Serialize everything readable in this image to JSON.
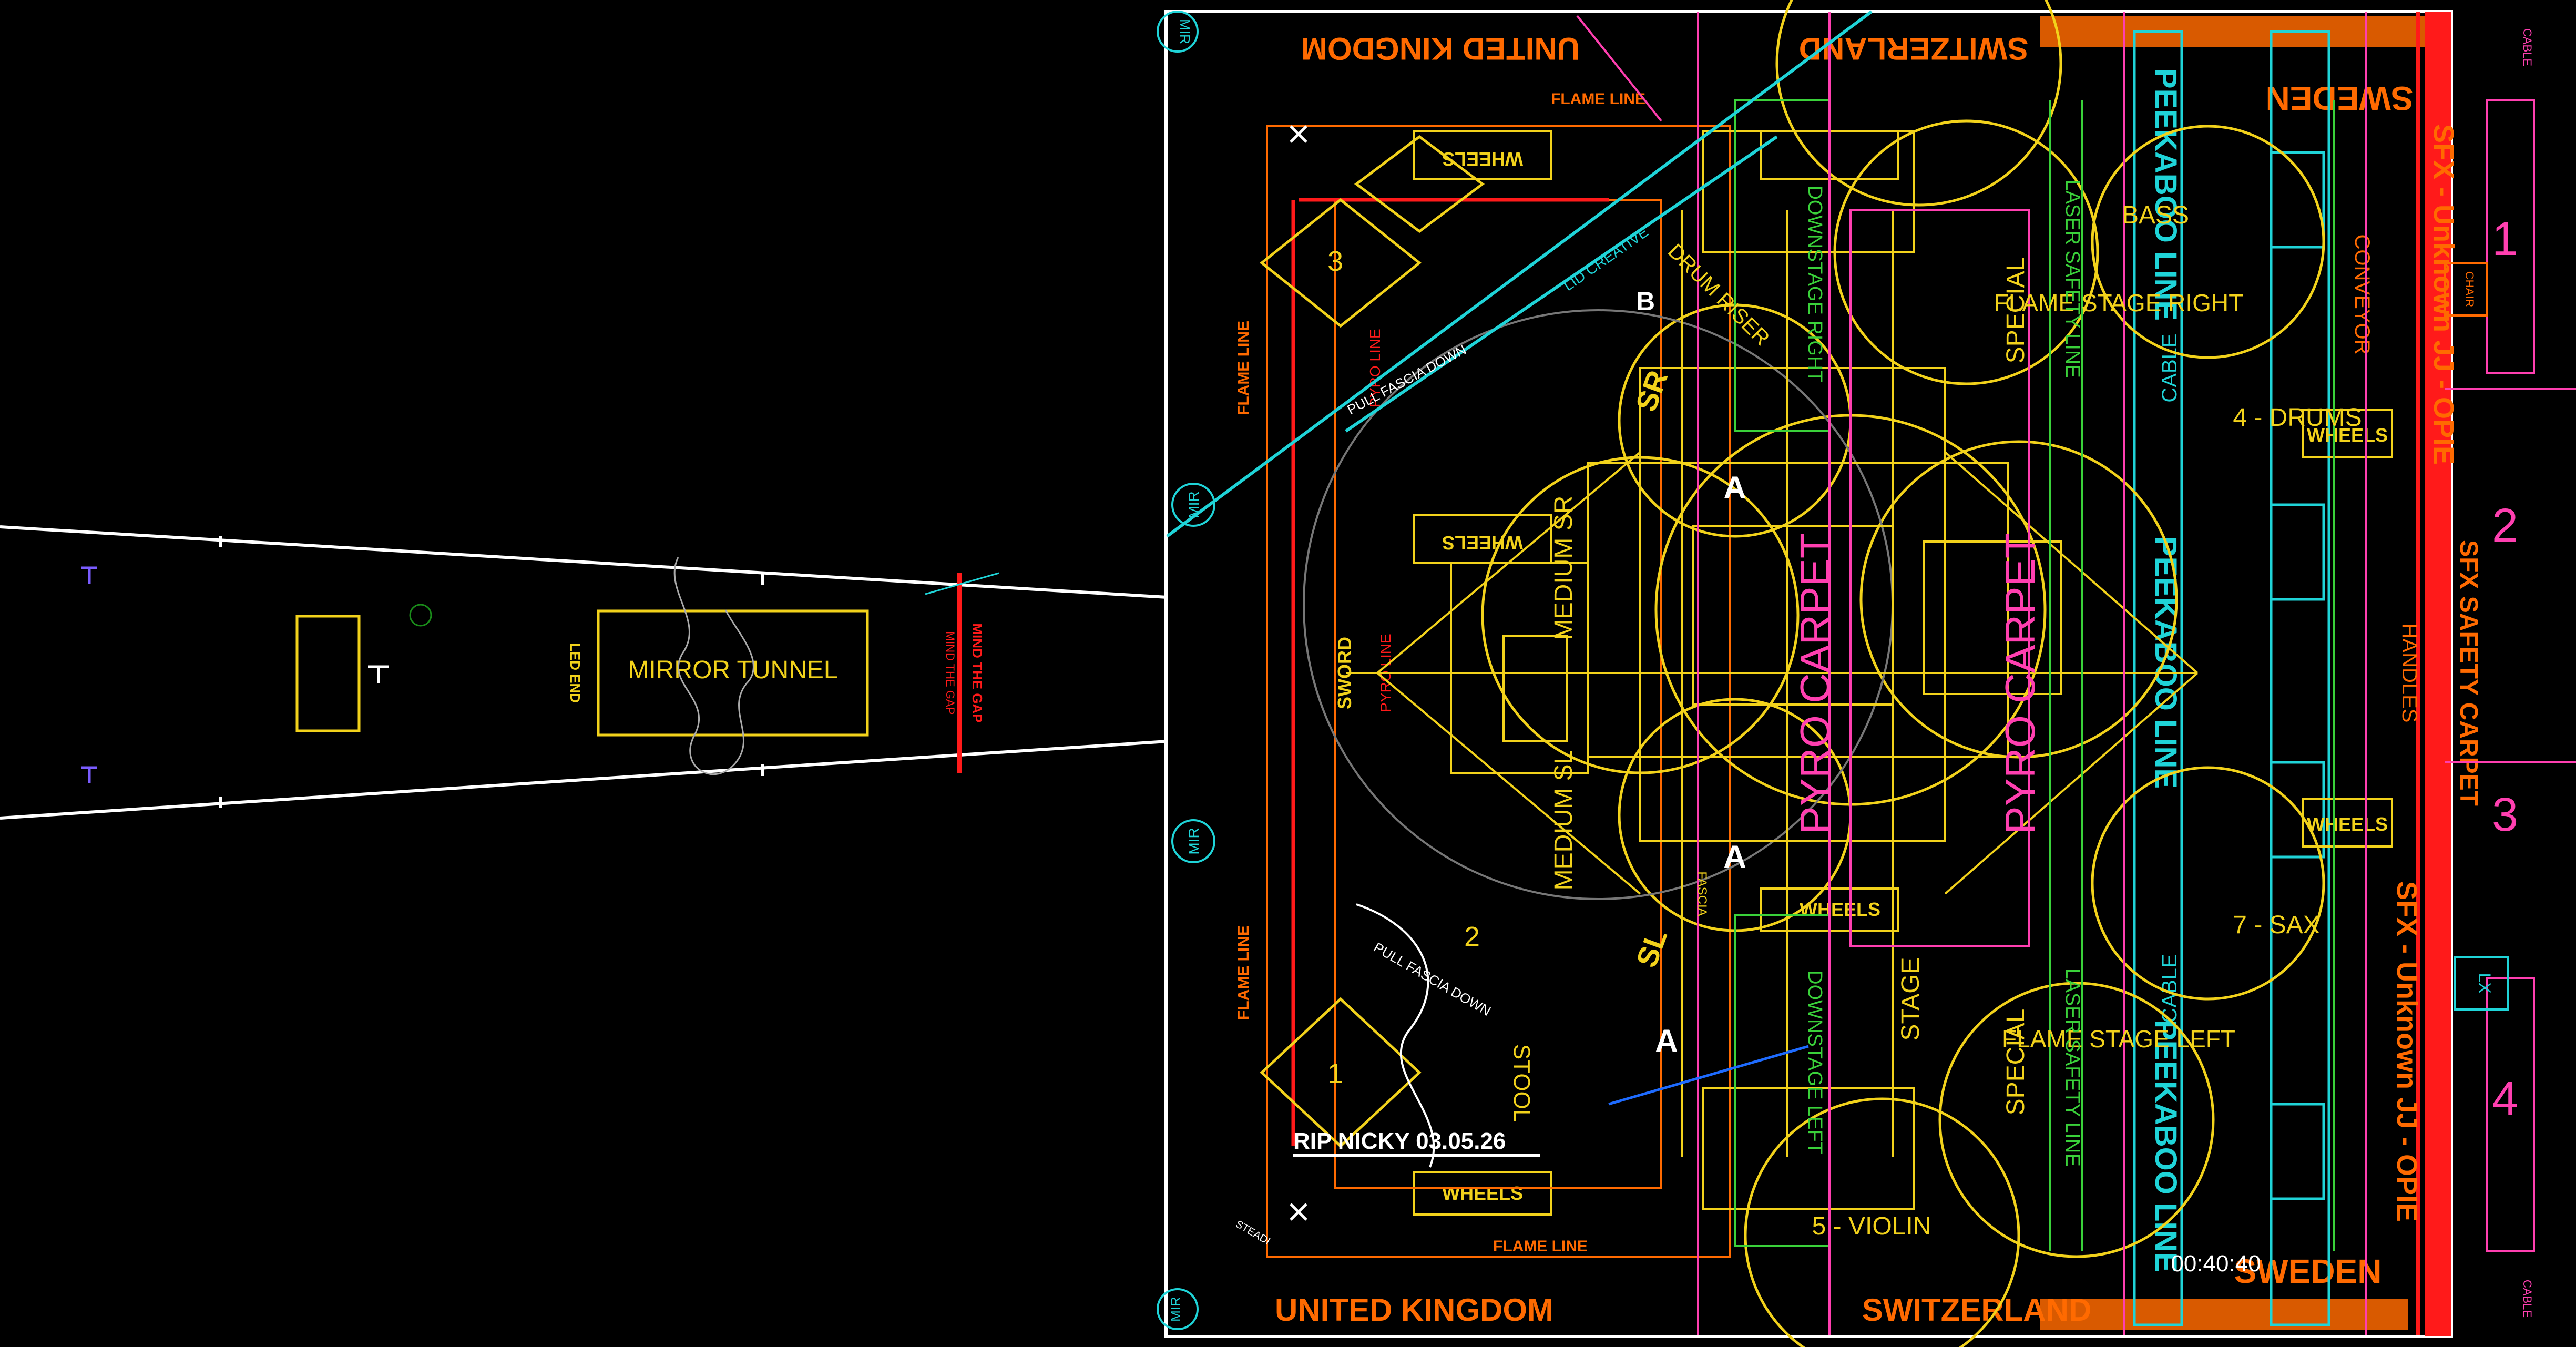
{
  "colors": {
    "background": "#000000",
    "yellow": "#f2d21b",
    "orange": "#ff6a00",
    "red": "#ff1a1a",
    "cyan": "#1fd4d8",
    "magenta": "#ff3fb0",
    "white": "#ffffff",
    "green": "#3ad13a",
    "purple": "#7a5cff",
    "blue": "#1e6bff"
  },
  "runway": {
    "mirror_tunnel": "MIRROR TUNNEL",
    "led_end": "LED END",
    "mind_the_gap_1": "MIND THE GAP",
    "mind_the_gap_2": "MIND THE GAP"
  },
  "countries": {
    "uk_top": "UNITED KINGDOM",
    "uk_bottom": "UNITED KINGDOM",
    "switzerland_top": "SWITZERLAND",
    "switzerland_bottom": "SWITZERLAND",
    "sweden_top": "SWEDEN",
    "sweden_bottom": "SWEDEN"
  },
  "stage_labels": {
    "flame_line": "FLAME LINE",
    "pyro_line": "PYRO LINE",
    "wheels": "WHEELS",
    "medium_sr": "MEDIUM SR",
    "medium_sl": "MEDIUM SL",
    "drum_riser": "DRUM RISER",
    "downstage_right": "DOWNSTAGE RIGHT",
    "downstage_left": "DOWNSTAGE LEFT",
    "flame_stage_right": "FLAME STAGE RIGHT",
    "flame_stage_left": "FLAME STAGE LEFT",
    "laser_safety_line": "LASER SAFETY LINE",
    "special": "SPECIAL",
    "pyro_carpet_1": "PYRO CARPET",
    "pyro_carpet_2": "PYRO CARPET",
    "sfx_safety_carpet": "SFX SAFETY CARPET",
    "handles": "HANDLES",
    "peekaboo_line": "PEEKABOO LINE",
    "cable": "CABLE",
    "bass": "BASS",
    "drums": "4 - DRUMS",
    "sax": "7 - SAX",
    "violin": "5 - VIOLIN",
    "sr": "SR",
    "sl": "SL",
    "stool": "STOOL",
    "stage": "STAGE",
    "mir": "MIR",
    "lx": "LX",
    "chair": "CHAIR",
    "sword": "SWORD",
    "pull_fascia_down_1": "PULL FASCIA DOWN",
    "pull_fascia_down_2": "PULL FASCIA DOWN",
    "rip": "RIP NICKY 03.05.26",
    "timer": "00:40:40",
    "unknown_top": "SFX - Unknown JJ - OPIE",
    "unknown_bottom": "SFX - Unknown JJ - OPIE",
    "conveyor": "CONVEYOR",
    "lid_creative": "LID CREATIVE",
    "stedi": "STEADI",
    "fascia": "FASCIA"
  },
  "numbers": {
    "n1": "1",
    "n2": "2",
    "n3": "3",
    "n4": "4"
  }
}
